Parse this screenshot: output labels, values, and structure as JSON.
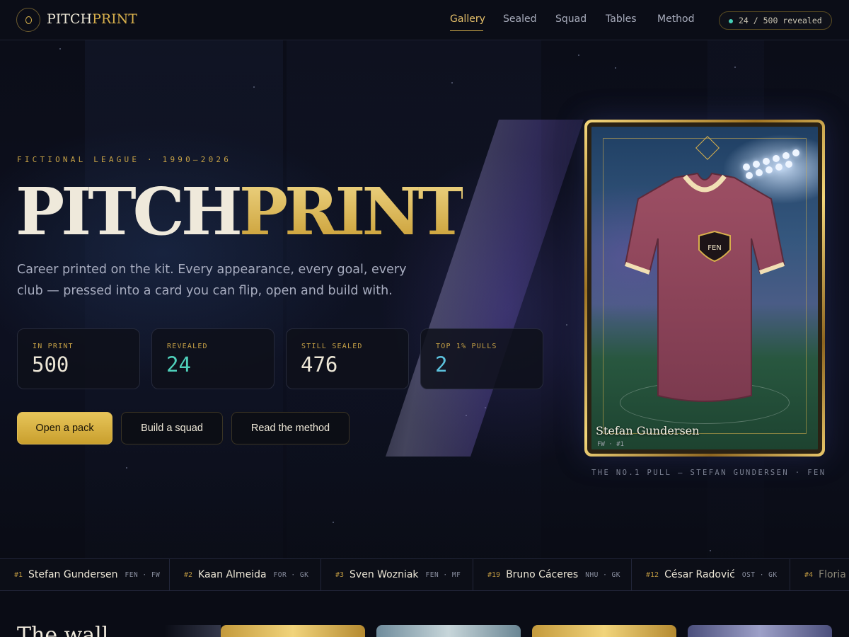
{
  "brand": {
    "name_white": "PITCH",
    "name_gold": "PRINT"
  },
  "nav": {
    "links": [
      "Gallery",
      "Sealed",
      "Squad",
      "Tables",
      "Method"
    ],
    "active": "Gallery",
    "progress_pill": "24 / 500 revealed"
  },
  "hero": {
    "eyebrow": "FICTIONAL LEAGUE · 1990–2026",
    "title_white": "PITCH",
    "title_gold": "PRINT",
    "subtitle": "Career printed on the kit. Every appearance, every goal, every club — pressed into a card you can flip, open and build with.",
    "stats": [
      {
        "label": "IN PRINT",
        "value": "500"
      },
      {
        "label": "REVEALED",
        "value": "24"
      },
      {
        "label": "STILL SEALED",
        "value": "476"
      },
      {
        "label": "TOP 1% PULLS",
        "value": "2"
      }
    ],
    "buttons": {
      "primary": "Open a pack",
      "secondary": "Build a squad",
      "tertiary": "Read the method"
    }
  },
  "feature_card": {
    "player": "Stefan Gundersen",
    "crest": "FEN",
    "meta": "FW · #1",
    "caption": "THE NO.1 PULL — STEFAN GUNDERSEN · FEN"
  },
  "ticker": [
    {
      "rank": "#1",
      "name": "Stefan Gundersen",
      "club": "FEN · FW"
    },
    {
      "rank": "#2",
      "name": "Kaan Almeida",
      "club": "FOR · GK"
    },
    {
      "rank": "#3",
      "name": "Sven Wozniak",
      "club": "FEN · MF"
    },
    {
      "rank": "#19",
      "name": "Bruno Cáceres",
      "club": "NHU · GK"
    },
    {
      "rank": "#12",
      "name": "César Radović",
      "club": "OST · GK"
    },
    {
      "rank": "#4",
      "name": "Floria",
      "club": ""
    }
  ],
  "wall": {
    "title": "The wall"
  },
  "colors": {
    "gold": "#d8b04c",
    "teal": "#4fd0bb",
    "blue": "#5cc2dd",
    "bg": "#0a0c15"
  }
}
